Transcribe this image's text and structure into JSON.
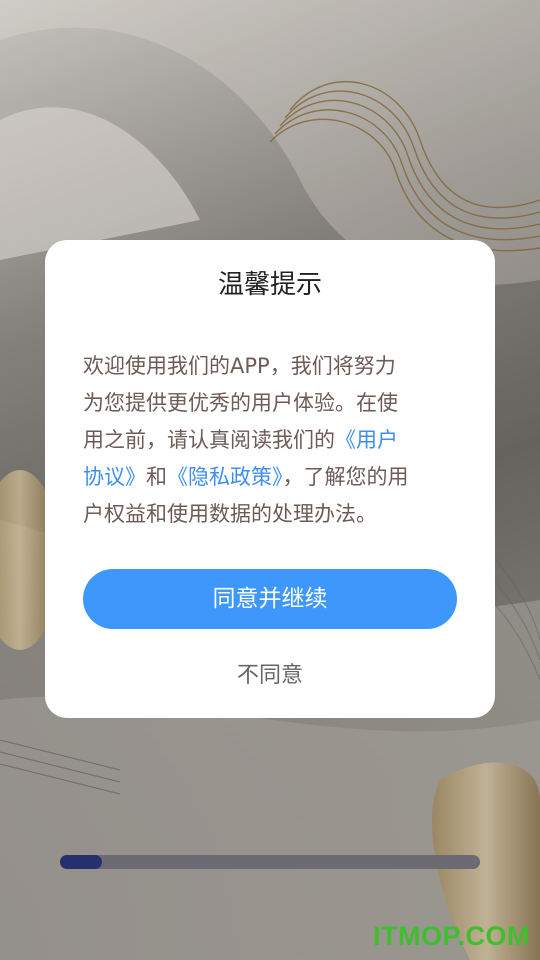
{
  "dialog": {
    "title": "温馨提示",
    "message_lines": [
      [
        {
          "text": "欢迎使用我们的APP，我们将努力",
          "link": false
        }
      ],
      [
        {
          "text": "为您提供更优秀的用户体验。在使",
          "link": false
        }
      ],
      [
        {
          "text": "用之前，请认真阅读我们的",
          "link": false
        },
        {
          "text": "《用户",
          "link": true
        }
      ],
      [
        {
          "text": "协议》",
          "link": true
        },
        {
          "text": "和",
          "link": false
        },
        {
          "text": "《隐私政策》",
          "link": true
        },
        {
          "text": "，了解您的用",
          "link": false
        }
      ],
      [
        {
          "text": "户权益和使用数据的处理办法。",
          "link": false
        }
      ]
    ],
    "agree_label": "同意并继续",
    "disagree_label": "不同意"
  },
  "progress": {
    "value": 0.1
  },
  "watermark": "ITMOP.COM",
  "colors": {
    "accent": "#3e97fb",
    "link": "#3e8ef0",
    "message_text": "#6e5b55",
    "progress_fill": "#26306e",
    "watermark": "#3fbf2e"
  }
}
